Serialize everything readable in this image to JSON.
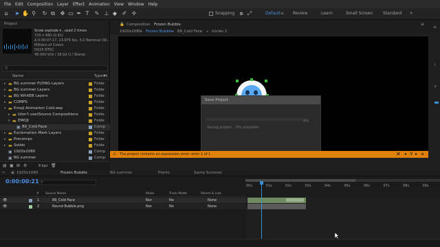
{
  "menu": [
    "File",
    "Edit",
    "Composition",
    "Layer",
    "Effect",
    "Animation",
    "View",
    "Window",
    "Help"
  ],
  "toolbar": {
    "snapping_label": "Snapping",
    "workspaces": [
      "Default",
      "Review",
      "Learn",
      "Small Screen",
      "Standard"
    ]
  },
  "project": {
    "title": "Project",
    "asset_name": "Snow explode ▾ , used 2 times",
    "info": [
      "720 x 480 (0.91)",
      "Δ 0:00:07:17, 23.976 fps, 3:2 Removal (W...",
      "Millions of Colors",
      "DV25 NTSC",
      "48.000 kHz / 16 bit U / Stereo"
    ],
    "col_name": "Name",
    "col_type": "Type",
    "items": [
      {
        "name": "BG summer FLYING Layers",
        "type": "Folde",
        "depth": 0,
        "expanded": false,
        "icon": "folder",
        "color": "#c9a227"
      },
      {
        "name": "BG summer Layers",
        "type": "Folde",
        "depth": 0,
        "expanded": false,
        "icon": "folder",
        "color": "#c9a227"
      },
      {
        "name": "BG WhitEB Layers",
        "type": "Folde",
        "depth": 0,
        "expanded": false,
        "icon": "folder",
        "color": "#c9a227"
      },
      {
        "name": "COMPS",
        "type": "Folde",
        "depth": 0,
        "expanded": false,
        "icon": "folder",
        "color": "#c9a227"
      },
      {
        "name": "Emoji Animation Cold.aep",
        "type": "Folde",
        "depth": 0,
        "expanded": true,
        "icon": "folder",
        "color": "#c9a227"
      },
      {
        "name": "(don't use)Source Compositions",
        "type": "Folde",
        "depth": 1,
        "expanded": false,
        "icon": "folder",
        "color": "#c9a227"
      },
      {
        "name": "EMOJI",
        "type": "Folde",
        "depth": 1,
        "expanded": true,
        "icon": "folder",
        "color": "#c9a227"
      },
      {
        "name": "89_Cold Face",
        "type": "Comp",
        "depth": 2,
        "expanded": null,
        "icon": "comp",
        "color": "#8aa0b8"
      },
      {
        "name": "Exclamation Mark Layers",
        "type": "Folde",
        "depth": 0,
        "expanded": false,
        "icon": "folder",
        "color": "#c9a227"
      },
      {
        "name": "Precomps",
        "type": "Folde",
        "depth": 0,
        "expanded": false,
        "icon": "folder",
        "color": "#c9a227"
      },
      {
        "name": "Solids",
        "type": "Folde",
        "depth": 0,
        "expanded": false,
        "icon": "folder",
        "color": "#c9a227"
      },
      {
        "name": "1920x1080",
        "type": "Comp",
        "depth": 0,
        "expanded": null,
        "icon": "comp",
        "color": "#8aa0b8"
      },
      {
        "name": "BG summer",
        "type": "Comp",
        "depth": 0,
        "expanded": null,
        "icon": "comp",
        "color": "#8aa0b8"
      }
    ],
    "bpc": "8 bpc"
  },
  "composition": {
    "panel_label": "Composition",
    "active_comp": "Frozen Bubble",
    "tabs": [
      "1920x1080",
      "Frozen Bubble",
      "89_Cold Face",
      "Icicles 2"
    ],
    "dialog_title": "Save Project",
    "dialog_status": "Saving project... 0% complete",
    "dialog_percent": "0%",
    "error_message": "The project contains an expression error: error 1 of 1"
  },
  "timeline": {
    "tabs": [
      "1920x1080",
      "Frozen Bubble",
      "BG summer",
      "Plants",
      "Santa Summer"
    ],
    "current_time": "0:00:00:21",
    "ruler": [
      "00s",
      "01s",
      "02s",
      "03s",
      "04s",
      "05s",
      "06s",
      "07s",
      "08s",
      "09s"
    ],
    "columns": {
      "num": "#",
      "source": "Source Name",
      "mode": "Mode",
      "trkmat": "Track Matte",
      "parent": "Parent & Link"
    },
    "layers": [
      {
        "num": "1",
        "name": "89_Cold Face",
        "mode": "Nor",
        "trkmat": "No",
        "parent": "None",
        "color": "#8aa0b8"
      },
      {
        "num": "2",
        "name": "Round Bubble.png",
        "mode": "Nor",
        "trkmat": "No",
        "parent": "None",
        "color": "#9ccf9c"
      }
    ]
  }
}
